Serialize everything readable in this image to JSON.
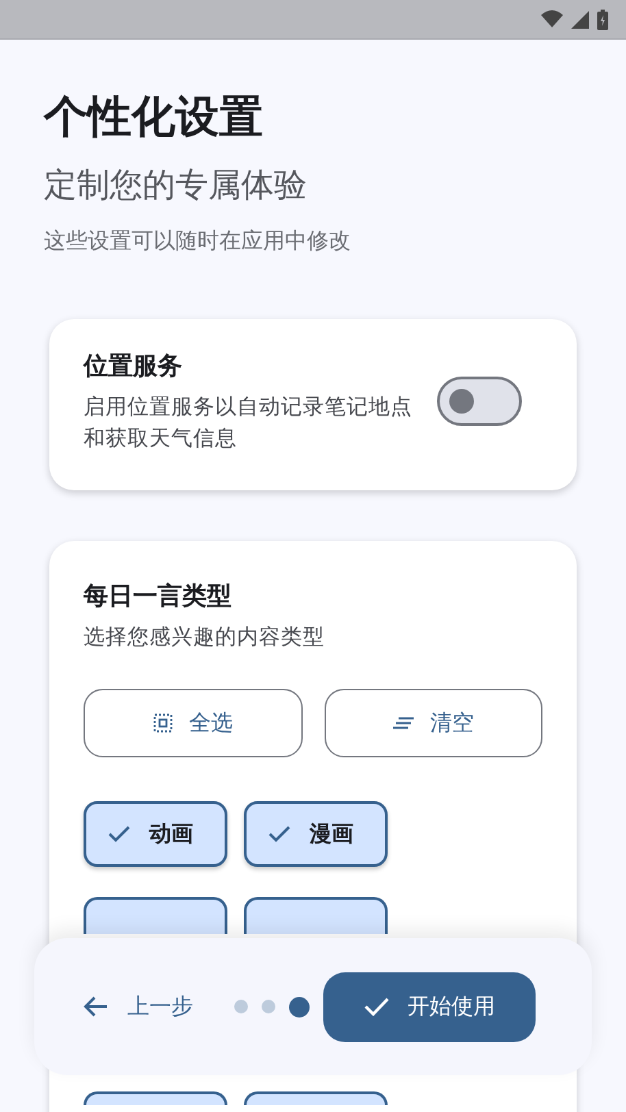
{
  "header": {
    "title": "个性化设置",
    "subtitle": "定制您的专属体验",
    "hint": "这些设置可以随时在应用中修改"
  },
  "location_card": {
    "title": "位置服务",
    "description": "启用位置服务以自动记录笔记地点和获取天气信息",
    "on": false
  },
  "quote_card": {
    "title": "每日一言类型",
    "description": "选择您感兴趣的内容类型",
    "actions": [
      {
        "kind": "select_all",
        "label": "全选"
      },
      {
        "kind": "clear",
        "label": "清空"
      }
    ],
    "chips": [
      {
        "label": "动画",
        "selected": true
      },
      {
        "label": "漫画",
        "selected": true
      },
      {
        "selected": true
      },
      {
        "selected": true
      },
      {
        "selected": true
      },
      {
        "selected": true
      }
    ]
  },
  "footer": {
    "back": "上一步",
    "steps": [
      {
        "selected": false
      },
      {
        "selected": false
      },
      {
        "selected": true
      }
    ],
    "primary": "开始使用"
  }
}
